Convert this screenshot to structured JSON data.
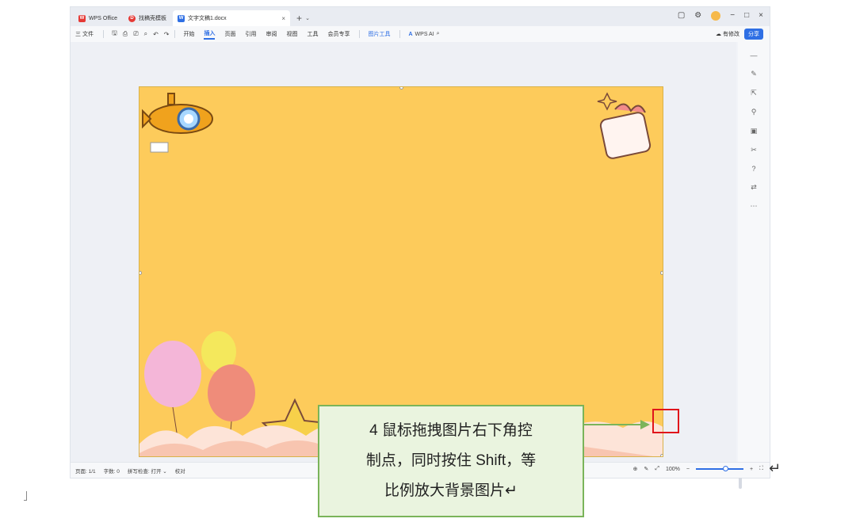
{
  "tabs": {
    "wps": "WPS Office",
    "template": "找稿壳模板",
    "document": "文字文稿1.docx",
    "close_glyph": "×",
    "new_glyph": "+",
    "dropdown_glyph": "⌄"
  },
  "window": {
    "restore": "▢",
    "settings": "⚙",
    "minimize": "−",
    "maximize": "□",
    "close": "×"
  },
  "ribbon": {
    "menu": "三 文件",
    "items": [
      "开始",
      "插入",
      "页面",
      "引用",
      "审阅",
      "视图",
      "工具",
      "会员专享"
    ],
    "active": "插入",
    "picture_tools": "图片工具",
    "ai": "WPS AI",
    "has_changes": "有修改",
    "share": "分享"
  },
  "statusbar": {
    "page": "页面: 1/1",
    "words": "字数: 0",
    "spell": "拼写检查: 打开 ⌄",
    "proof": "校对",
    "zoom": "100%",
    "minus": "−",
    "plus": "+"
  },
  "annotation": {
    "line1": "4 鼠标拖拽图片右下角控",
    "line2": "制点，同时按住 Shift，等",
    "line3": "比例放大背景图片↵"
  },
  "return_mark": "↵",
  "colors": {
    "accent": "#2f6fe4",
    "background_image": "#fdcb5b",
    "annotation_border": "#7ab45a",
    "annotation_fill": "#eaf4df",
    "highlight_red": "#e0151b"
  }
}
